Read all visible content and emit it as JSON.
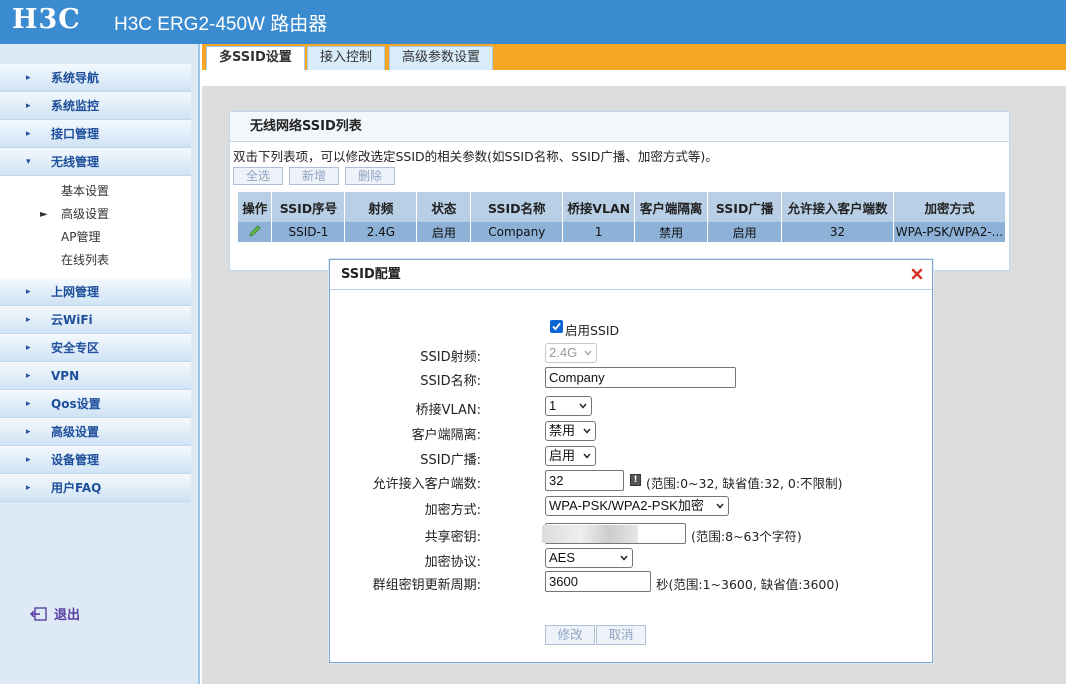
{
  "header": {
    "logo": "H3C",
    "title": "H3C ERG2-450W 路由器"
  },
  "sidebar": {
    "items": [
      {
        "label": "系统导航"
      },
      {
        "label": "系统监控"
      },
      {
        "label": "接口管理"
      },
      {
        "label": "无线管理"
      },
      {
        "label": "上网管理"
      },
      {
        "label": "云WiFi"
      },
      {
        "label": "安全专区"
      },
      {
        "label": "VPN"
      },
      {
        "label": "Qos设置"
      },
      {
        "label": "高级设置"
      },
      {
        "label": "设备管理"
      },
      {
        "label": "用户FAQ"
      }
    ],
    "sub_items": [
      {
        "label": "基本设置"
      },
      {
        "label": "高级设置"
      },
      {
        "label": "AP管理"
      },
      {
        "label": "在线列表"
      }
    ],
    "logout": "退出"
  },
  "tabs": [
    {
      "label": "多SSID设置"
    },
    {
      "label": "接入控制"
    },
    {
      "label": "高级参数设置"
    }
  ],
  "panel": {
    "title": "无线网络SSID列表",
    "desc": "双击下列表项，可以修改选定SSID的相关参数(如SSID名称、SSID广播、加密方式等)。",
    "buttons": {
      "select_all": "全选",
      "add": "新增",
      "delete": "删除"
    },
    "columns": [
      "操作",
      "SSID序号",
      "射频",
      "状态",
      "SSID名称",
      "桥接VLAN",
      "客户端隔离",
      "SSID广播",
      "允许接入客户端数",
      "加密方式"
    ],
    "row": {
      "index": "SSID-1",
      "band": "2.4G",
      "status": "启用",
      "name": "Company",
      "vlan": "1",
      "isolation": "禁用",
      "broadcast": "启用",
      "max_clients": "32",
      "encryption": "WPA-PSK/WPA2-..."
    }
  },
  "dialog": {
    "title": "SSID配置",
    "enable_label": "启用SSID",
    "band_label": "SSID射频:",
    "band_value": "2.4G",
    "name_label": "SSID名称:",
    "name_value": "Company",
    "vlan_label": "桥接VLAN:",
    "vlan_value": "1",
    "isolation_label": "客户端隔离:",
    "isolation_value": "禁用",
    "broadcast_label": "SSID广播:",
    "broadcast_value": "启用",
    "max_clients_label": "允许接入客户端数:",
    "max_clients_value": "32",
    "max_clients_hint": "(范围:0~32, 缺省值:32, 0:不限制)",
    "encryption_label": "加密方式:",
    "encryption_value": "WPA-PSK/WPA2-PSK加密",
    "key_label": "共享密钥:",
    "key_hint": "(范围:8~63个字符)",
    "cipher_label": "加密协议:",
    "cipher_value": "AES",
    "rekey_label": "群组密钥更新周期:",
    "rekey_value": "3600",
    "rekey_hint": "秒(范围:1~3600, 缺省值:3600)",
    "modify_button": "修改",
    "cancel_button": "取消"
  }
}
